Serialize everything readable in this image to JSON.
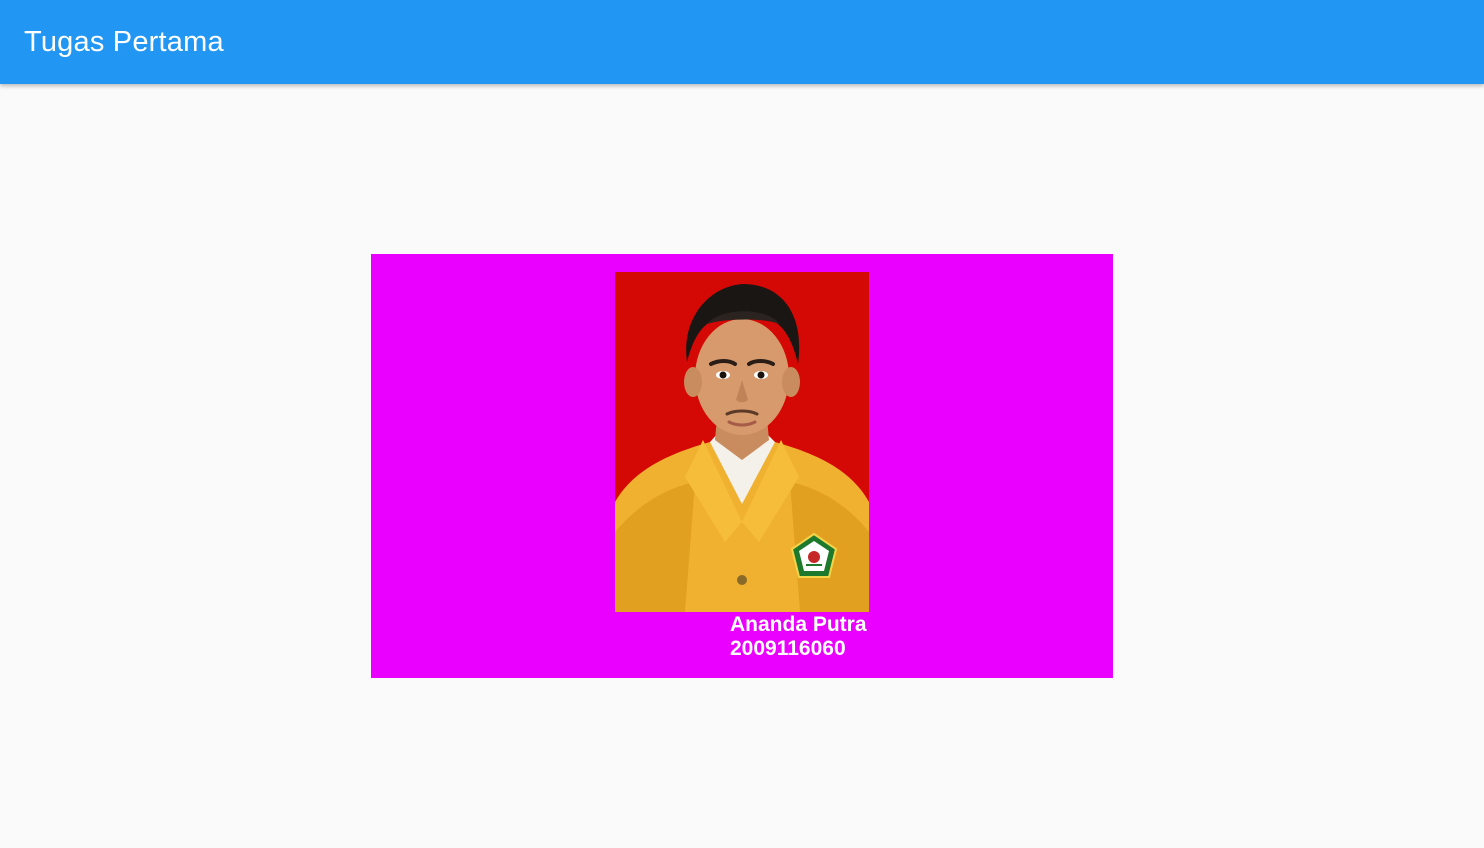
{
  "app_bar": {
    "title": "Tugas Pertama",
    "color": "#2196f3"
  },
  "card": {
    "background": "#ea00ff",
    "photo": {
      "description_icon": "profile-photo",
      "background": "#d40804"
    },
    "name": "Ananda Putra",
    "student_id": "2009116060"
  }
}
